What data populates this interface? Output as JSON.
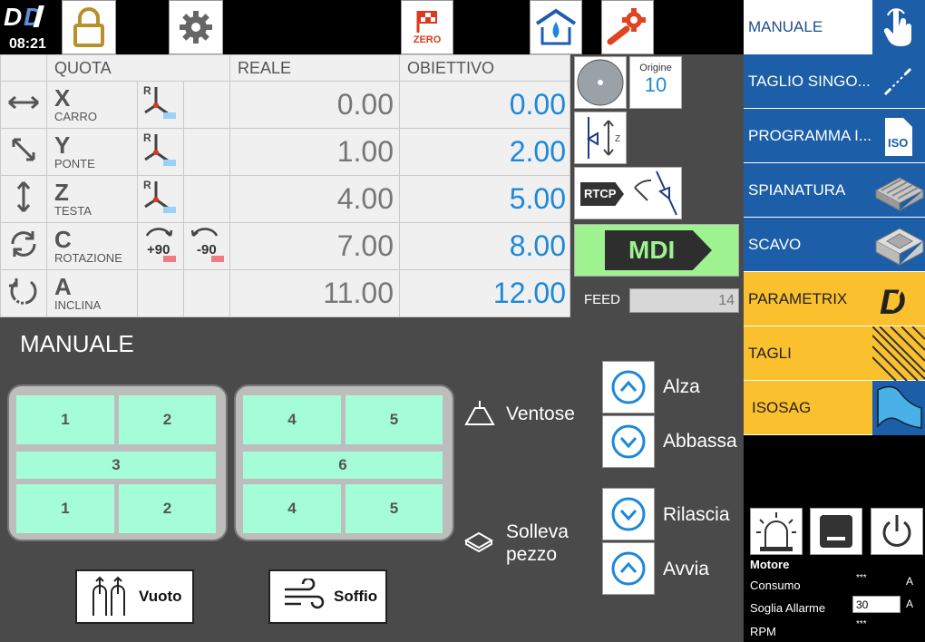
{
  "header": {
    "time": "08:21",
    "zero_label": "ZERO"
  },
  "table": {
    "headers": {
      "quota": "QUOTA",
      "reale": "REALE",
      "obiettivo": "OBIETTIVO"
    },
    "rows": [
      {
        "axis": "X",
        "sub": "CARRO",
        "reale": "0.00",
        "obiettivo": "0.00"
      },
      {
        "axis": "Y",
        "sub": "PONTE",
        "reale": "1.00",
        "obiettivo": "2.00"
      },
      {
        "axis": "Z",
        "sub": "TESTA",
        "reale": "4.00",
        "obiettivo": "5.00"
      },
      {
        "axis": "C",
        "sub": "ROTAZIONE",
        "reale": "7.00",
        "obiettivo": "8.00",
        "rot_plus": "+90",
        "rot_minus": "-90"
      },
      {
        "axis": "A",
        "sub": "INCLINA",
        "reale": "11.00",
        "obiettivo": "12.00"
      }
    ],
    "r_label": "R"
  },
  "mid": {
    "origine_label": "Origine",
    "origine_value": "10",
    "rtcp_label": "RTCP",
    "z_label": "Z",
    "mdi_label": "MDI",
    "feed_label": "FEED",
    "feed_value": "14"
  },
  "sidebar": [
    {
      "label": "MANUALE",
      "bg": "#ffffff",
      "fg": "#1c4f8f"
    },
    {
      "label": "TAGLIO SINGO...",
      "bg": "#1c5ea8",
      "fg": "#ffffff"
    },
    {
      "label": "PROGRAMMA I...",
      "bg": "#1c5ea8",
      "fg": "#ffffff"
    },
    {
      "label": "SPIANATURA",
      "bg": "#1c5ea8",
      "fg": "#ffffff"
    },
    {
      "label": "SCAVO",
      "bg": "#1c5ea8",
      "fg": "#ffffff"
    },
    {
      "label": "PARAMETRIX",
      "bg": "#fbc02d",
      "fg": "#222222"
    },
    {
      "label": "TAGLI",
      "bg": "#fbc02d",
      "fg": "#222222"
    },
    {
      "label": "ISOSAG",
      "bg": "#fbc02d",
      "fg": "#222222"
    }
  ],
  "manual": {
    "title": "MANUALE",
    "grid_left": [
      "1",
      "2",
      "3",
      "1",
      "2"
    ],
    "grid_right": [
      "4",
      "5",
      "6",
      "4",
      "5"
    ],
    "ventose": "Ventose",
    "solleva": [
      "Solleva",
      "pezzo"
    ],
    "alza": "Alza",
    "abbassa": "Abbassa",
    "rilascia": "Rilascia",
    "avvia": "Avvia",
    "vuoto": "Vuoto",
    "soffio": "Soffio"
  },
  "motor": {
    "title": "Motore",
    "consumo_label": "Consumo",
    "consumo_value": "***",
    "consumo_unit": "A",
    "soglia_label": "Soglia Allarme",
    "soglia_value": "30",
    "soglia_unit": "A",
    "rpm_label": "RPM",
    "rpm_value": "***"
  }
}
